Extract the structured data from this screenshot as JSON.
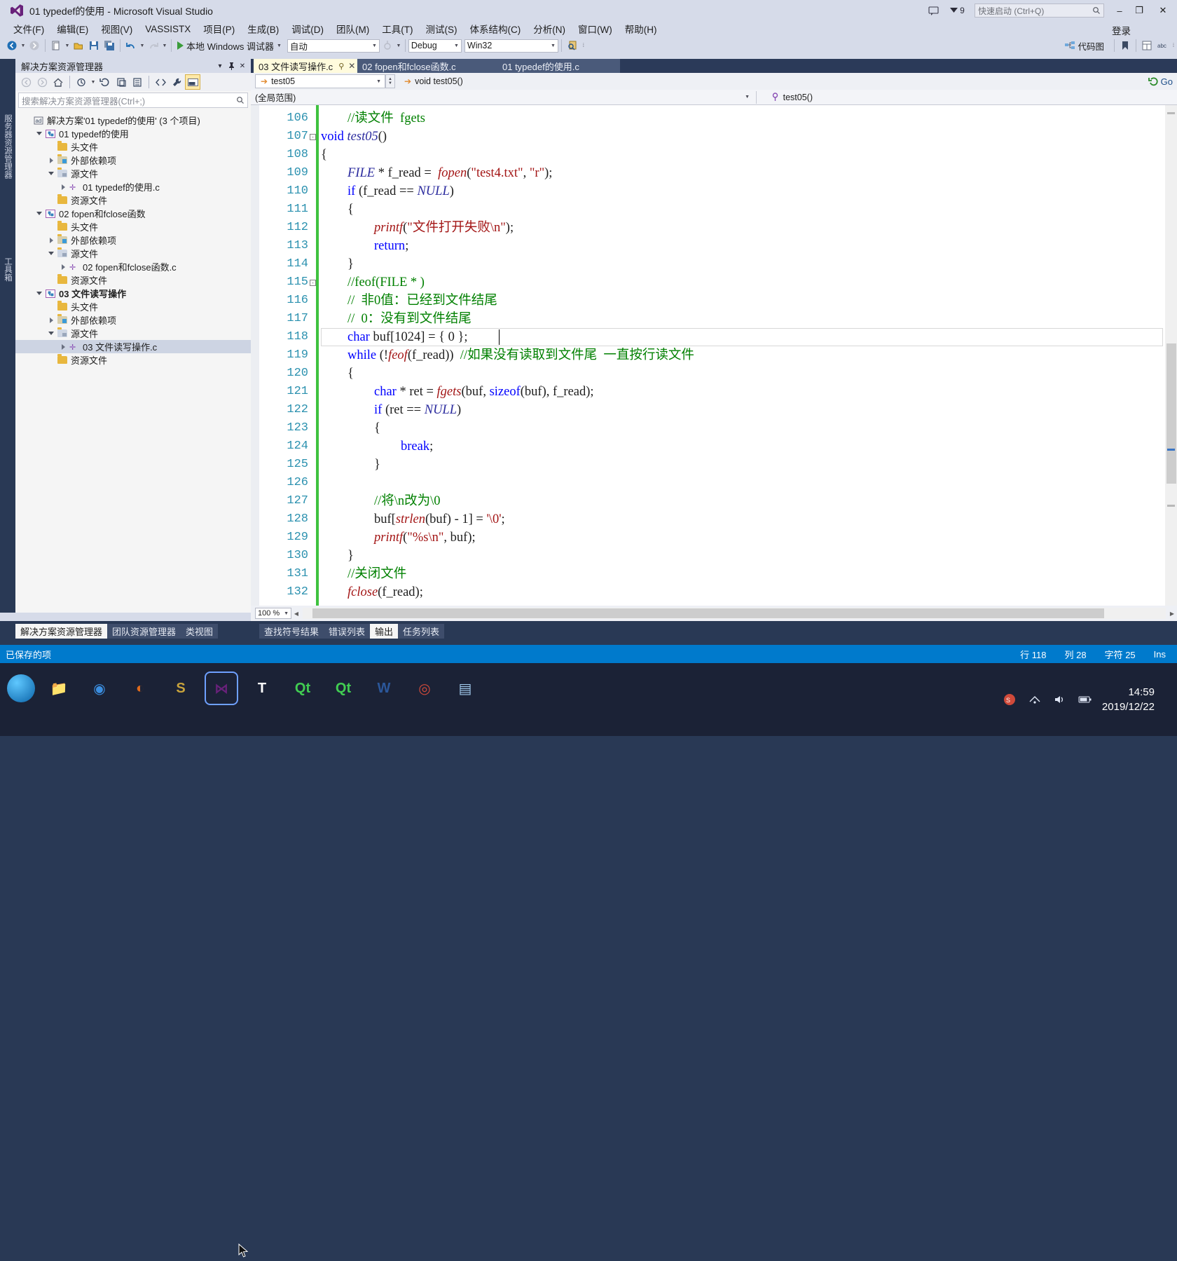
{
  "window": {
    "title": "01 typedef的使用 - Microsoft Visual Studio",
    "logo_icon": "visual-studio-logo",
    "feedback_icon": "feedback-icon",
    "notifications_icon": "notifications-flag-icon",
    "notifications_count": "9",
    "quick_launch_placeholder": "快速启动 (Ctrl+Q)",
    "search_icon": "search-icon",
    "minimize": "–",
    "maximize": "❐",
    "close": "✕",
    "signin": "登录"
  },
  "menubar": {
    "items": [
      "文件(F)",
      "编辑(E)",
      "视图(V)",
      "VASSISTX",
      "项目(P)",
      "生成(B)",
      "调试(D)",
      "团队(M)",
      "工具(T)",
      "测试(S)",
      "体系结构(C)",
      "分析(N)",
      "窗口(W)",
      "帮助(H)"
    ]
  },
  "toolbar": {
    "back_icon": "navigate-back-icon",
    "forward_icon": "navigate-forward-icon",
    "new_icon": "new-file-icon",
    "open_icon": "open-file-icon",
    "save_icon": "save-icon",
    "save_all_icon": "save-all-icon",
    "undo_icon": "undo-icon",
    "redo_icon": "redo-icon",
    "run_label": "本地 Windows 调试器",
    "run_icon": "play-icon",
    "config_value": "自动",
    "solution_config": "Debug",
    "platform": "Win32",
    "find_icon": "find-in-files-icon",
    "step_icon": "step-icon",
    "code_map_label": "代码图",
    "bookmark_icon": "bookmark-icon",
    "properties_icon": "properties-icon",
    "abc_icon": "abc-icon"
  },
  "left_strip": {
    "tabs": [
      "服务器资源管理器",
      "工具箱"
    ]
  },
  "solution_explorer": {
    "title": "解决方案资源管理器",
    "dropdown_icon": "chevron-down-icon",
    "pin_icon": "pin-icon",
    "close_icon": "close-icon",
    "toolbar_icons": [
      "back-icon",
      "forward-icon",
      "home-icon",
      "pending-changes-icon",
      "refresh-icon",
      "show-all-files-icon",
      "collapse-all-icon",
      "code-view-icon",
      "properties-wrench-icon",
      "preview-pane-icon"
    ],
    "search_placeholder": "搜索解决方案资源管理器(Ctrl+;)",
    "search_icon": "search-icon",
    "tree": [
      {
        "label": "解决方案'01 typedef的使用' (3 个项目)",
        "indent": 0,
        "twisty": "none",
        "icon": "solution-icon",
        "bold": false,
        "selected": false
      },
      {
        "label": "01 typedef的使用",
        "indent": 1,
        "twisty": "open",
        "icon": "project-icon",
        "bold": false,
        "selected": false
      },
      {
        "label": "头文件",
        "indent": 2,
        "twisty": "none",
        "icon": "folder-icon",
        "bold": false,
        "selected": false
      },
      {
        "label": "外部依赖项",
        "indent": 2,
        "twisty": "closed",
        "icon": "folder-ext-icon",
        "bold": false,
        "selected": false
      },
      {
        "label": "源文件",
        "indent": 2,
        "twisty": "open",
        "icon": "folder-src-icon",
        "bold": false,
        "selected": false
      },
      {
        "label": "01 typedef的使用.c",
        "indent": 3,
        "twisty": "closed",
        "icon": "c-file-icon",
        "bold": false,
        "selected": false
      },
      {
        "label": "资源文件",
        "indent": 2,
        "twisty": "none",
        "icon": "folder-icon",
        "bold": false,
        "selected": false
      },
      {
        "label": "02 fopen和fclose函数",
        "indent": 1,
        "twisty": "open",
        "icon": "project-icon",
        "bold": false,
        "selected": false
      },
      {
        "label": "头文件",
        "indent": 2,
        "twisty": "none",
        "icon": "folder-icon",
        "bold": false,
        "selected": false
      },
      {
        "label": "外部依赖项",
        "indent": 2,
        "twisty": "closed",
        "icon": "folder-ext-icon",
        "bold": false,
        "selected": false
      },
      {
        "label": "源文件",
        "indent": 2,
        "twisty": "open",
        "icon": "folder-src-icon",
        "bold": false,
        "selected": false
      },
      {
        "label": "02 fopen和fclose函数.c",
        "indent": 3,
        "twisty": "closed",
        "icon": "c-file-icon",
        "bold": false,
        "selected": false
      },
      {
        "label": "资源文件",
        "indent": 2,
        "twisty": "none",
        "icon": "folder-icon",
        "bold": false,
        "selected": false
      },
      {
        "label": "03 文件读写操作",
        "indent": 1,
        "twisty": "open",
        "icon": "project-icon",
        "bold": true,
        "selected": false
      },
      {
        "label": "头文件",
        "indent": 2,
        "twisty": "none",
        "icon": "folder-icon",
        "bold": false,
        "selected": false
      },
      {
        "label": "外部依赖项",
        "indent": 2,
        "twisty": "closed",
        "icon": "folder-ext-icon",
        "bold": false,
        "selected": false
      },
      {
        "label": "源文件",
        "indent": 2,
        "twisty": "open",
        "icon": "folder-src-icon",
        "bold": false,
        "selected": false
      },
      {
        "label": "03 文件读写操作.c",
        "indent": 3,
        "twisty": "closed",
        "icon": "c-file-icon",
        "bold": false,
        "selected": true
      },
      {
        "label": "资源文件",
        "indent": 2,
        "twisty": "none",
        "icon": "folder-icon",
        "bold": false,
        "selected": false
      }
    ]
  },
  "editor": {
    "tabs": [
      {
        "label": "03 文件读写操作.c",
        "active": true,
        "pin": "⚲",
        "close": "✕"
      },
      {
        "label": "02 fopen和fclose函数.c",
        "active": false,
        "pin": "",
        "close": ""
      },
      {
        "label": "01 typedef的使用.c",
        "active": false,
        "pin": "",
        "close": ""
      }
    ],
    "nav_left_value": "test05",
    "nav_right_value": "void test05()",
    "nav_arrow_icon": "goto-arrow-icon",
    "scope_left": "(全局范围)",
    "scope_right": "test05()",
    "scope_right_icon": "method-icon",
    "go_button": "Go",
    "go_icon": "refresh-go-icon",
    "zoom": "100 %",
    "lines": [
      {
        "n": "106",
        "fold": "",
        "indent": 1,
        "tokens": [
          {
            "t": "//读文件  fgets",
            "c": "cm"
          }
        ]
      },
      {
        "n": "107",
        "fold": "-",
        "indent": 0,
        "tokens": [
          {
            "t": "void",
            "c": "kw"
          },
          {
            "t": " ",
            "c": "pl"
          },
          {
            "t": "test05",
            "c": "ty"
          },
          {
            "t": "()",
            "c": "pl"
          }
        ]
      },
      {
        "n": "108",
        "fold": "",
        "indent": 0,
        "tokens": [
          {
            "t": "{",
            "c": "pl"
          }
        ]
      },
      {
        "n": "109",
        "fold": "",
        "indent": 1,
        "tokens": [
          {
            "t": "FILE",
            "c": "ty"
          },
          {
            "t": " * f_read =  ",
            "c": "pl"
          },
          {
            "t": "fopen",
            "c": "fn"
          },
          {
            "t": "(",
            "c": "pl"
          },
          {
            "t": "\"test4.txt\"",
            "c": "str"
          },
          {
            "t": ", ",
            "c": "pl"
          },
          {
            "t": "\"r\"",
            "c": "str"
          },
          {
            "t": ");",
            "c": "pl"
          }
        ]
      },
      {
        "n": "110",
        "fold": "",
        "indent": 1,
        "tokens": [
          {
            "t": "if",
            "c": "kw"
          },
          {
            "t": " (f_read == ",
            "c": "pl"
          },
          {
            "t": "NULL",
            "c": "ty"
          },
          {
            "t": ")",
            "c": "pl"
          }
        ]
      },
      {
        "n": "111",
        "fold": "",
        "indent": 1,
        "tokens": [
          {
            "t": "{",
            "c": "pl"
          }
        ]
      },
      {
        "n": "112",
        "fold": "",
        "indent": 2,
        "tokens": [
          {
            "t": "printf",
            "c": "fn"
          },
          {
            "t": "(",
            "c": "pl"
          },
          {
            "t": "\"文件打开失败\\n\"",
            "c": "str"
          },
          {
            "t": ");",
            "c": "pl"
          }
        ]
      },
      {
        "n": "113",
        "fold": "",
        "indent": 2,
        "tokens": [
          {
            "t": "return",
            "c": "kw"
          },
          {
            "t": ";",
            "c": "pl"
          }
        ]
      },
      {
        "n": "114",
        "fold": "",
        "indent": 1,
        "tokens": [
          {
            "t": "}",
            "c": "pl"
          }
        ]
      },
      {
        "n": "115",
        "fold": "-",
        "indent": 1,
        "tokens": [
          {
            "t": "//feof(FILE * )",
            "c": "cm"
          }
        ]
      },
      {
        "n": "116",
        "fold": "",
        "indent": 1,
        "tokens": [
          {
            "t": "//  非0值：已经到文件结尾",
            "c": "cm"
          }
        ]
      },
      {
        "n": "117",
        "fold": "",
        "indent": 1,
        "tokens": [
          {
            "t": "//  0：没有到文件结尾",
            "c": "cm"
          }
        ]
      },
      {
        "n": "118",
        "fold": "",
        "indent": 1,
        "tokens": [
          {
            "t": "char",
            "c": "kw"
          },
          {
            "t": " buf[1024] = { 0 };",
            "c": "pl"
          }
        ]
      },
      {
        "n": "119",
        "fold": "",
        "indent": 1,
        "tokens": [
          {
            "t": "while",
            "c": "kw"
          },
          {
            "t": " (!",
            "c": "pl"
          },
          {
            "t": "feof",
            "c": "fn"
          },
          {
            "t": "(f_read))  ",
            "c": "pl"
          },
          {
            "t": "//如果没有读取到文件尾  一直按行读文件",
            "c": "cm"
          }
        ]
      },
      {
        "n": "120",
        "fold": "",
        "indent": 1,
        "tokens": [
          {
            "t": "{",
            "c": "pl"
          }
        ]
      },
      {
        "n": "121",
        "fold": "",
        "indent": 2,
        "tokens": [
          {
            "t": "char",
            "c": "kw"
          },
          {
            "t": " * ret = ",
            "c": "pl"
          },
          {
            "t": "fgets",
            "c": "fn"
          },
          {
            "t": "(buf, ",
            "c": "pl"
          },
          {
            "t": "sizeof",
            "c": "kw"
          },
          {
            "t": "(buf), f_read);",
            "c": "pl"
          }
        ]
      },
      {
        "n": "122",
        "fold": "",
        "indent": 2,
        "tokens": [
          {
            "t": "if",
            "c": "kw"
          },
          {
            "t": " (ret == ",
            "c": "pl"
          },
          {
            "t": "NULL",
            "c": "ty"
          },
          {
            "t": ")",
            "c": "pl"
          }
        ]
      },
      {
        "n": "123",
        "fold": "",
        "indent": 2,
        "tokens": [
          {
            "t": "{",
            "c": "pl"
          }
        ]
      },
      {
        "n": "124",
        "fold": "",
        "indent": 3,
        "tokens": [
          {
            "t": "break",
            "c": "kw"
          },
          {
            "t": ";",
            "c": "pl"
          }
        ]
      },
      {
        "n": "125",
        "fold": "",
        "indent": 2,
        "tokens": [
          {
            "t": "}",
            "c": "pl"
          }
        ]
      },
      {
        "n": "126",
        "fold": "",
        "indent": 0,
        "tokens": []
      },
      {
        "n": "127",
        "fold": "",
        "indent": 2,
        "tokens": [
          {
            "t": "//将\\n改为\\0",
            "c": "cm"
          }
        ]
      },
      {
        "n": "128",
        "fold": "",
        "indent": 2,
        "tokens": [
          {
            "t": "buf[",
            "c": "pl"
          },
          {
            "t": "strlen",
            "c": "fn"
          },
          {
            "t": "(buf) - 1] = ",
            "c": "pl"
          },
          {
            "t": "'\\0'",
            "c": "str"
          },
          {
            "t": ";",
            "c": "pl"
          }
        ]
      },
      {
        "n": "129",
        "fold": "",
        "indent": 2,
        "tokens": [
          {
            "t": "printf",
            "c": "fn"
          },
          {
            "t": "(",
            "c": "pl"
          },
          {
            "t": "\"%s\\n\"",
            "c": "str"
          },
          {
            "t": ", buf);",
            "c": "pl"
          }
        ]
      },
      {
        "n": "130",
        "fold": "",
        "indent": 1,
        "tokens": [
          {
            "t": "}",
            "c": "pl"
          }
        ]
      },
      {
        "n": "131",
        "fold": "",
        "indent": 1,
        "tokens": [
          {
            "t": "//关闭文件",
            "c": "cm"
          }
        ]
      },
      {
        "n": "132",
        "fold": "",
        "indent": 1,
        "tokens": [
          {
            "t": "fclose",
            "c": "fn"
          },
          {
            "t": "(f_read);",
            "c": "pl"
          }
        ]
      }
    ],
    "current_line_index": 12
  },
  "bottom_tabs": {
    "left": [
      "解决方案资源管理器",
      "团队资源管理器",
      "类视图"
    ],
    "left_active": "解决方案资源管理器",
    "right": [
      "查找符号结果",
      "错误列表",
      "输出",
      "任务列表"
    ],
    "right_active": "输出"
  },
  "status": {
    "message": "已保存的项",
    "line_label": "行 118",
    "col_label": "列 28",
    "char_label": "字符 25",
    "insert_mode": "Ins"
  },
  "taskbar": {
    "start_icon": "start-orb-icon",
    "apps": [
      {
        "name": "file-explorer-icon",
        "glyph": "📁",
        "color": "#e3b23c",
        "selected": false
      },
      {
        "name": "chrome-icon",
        "glyph": "◉",
        "color": "#3b8ee0",
        "selected": false
      },
      {
        "name": "firefox-icon",
        "glyph": "◐",
        "color": "#e06a1b",
        "selected": false
      },
      {
        "name": "sublime-icon",
        "glyph": "S",
        "color": "#c8a33c",
        "selected": false
      },
      {
        "name": "visual-studio-icon",
        "glyph": "⋈",
        "color": "#68217a",
        "selected": true
      },
      {
        "name": "typora-icon",
        "glyph": "T",
        "color": "#ffffff",
        "selected": false
      },
      {
        "name": "qt-creator-icon",
        "glyph": "Qt",
        "color": "#41cd52",
        "selected": false
      },
      {
        "name": "qt-designer-icon",
        "glyph": "Qt",
        "color": "#41cd52",
        "selected": false
      },
      {
        "name": "word-icon",
        "glyph": "W",
        "color": "#2b579a",
        "selected": false
      },
      {
        "name": "browser-icon",
        "glyph": "◎",
        "color": "#d04a3a",
        "selected": false
      },
      {
        "name": "notepad-icon",
        "glyph": "▤",
        "color": "#9fc8ea",
        "selected": false
      }
    ],
    "tray_icons": [
      "ime-icon",
      "volume-icon",
      "network-icon",
      "battery-icon",
      "show-desktop-icon"
    ],
    "clock_time": "14:59",
    "clock_date": "2019/12/22"
  }
}
